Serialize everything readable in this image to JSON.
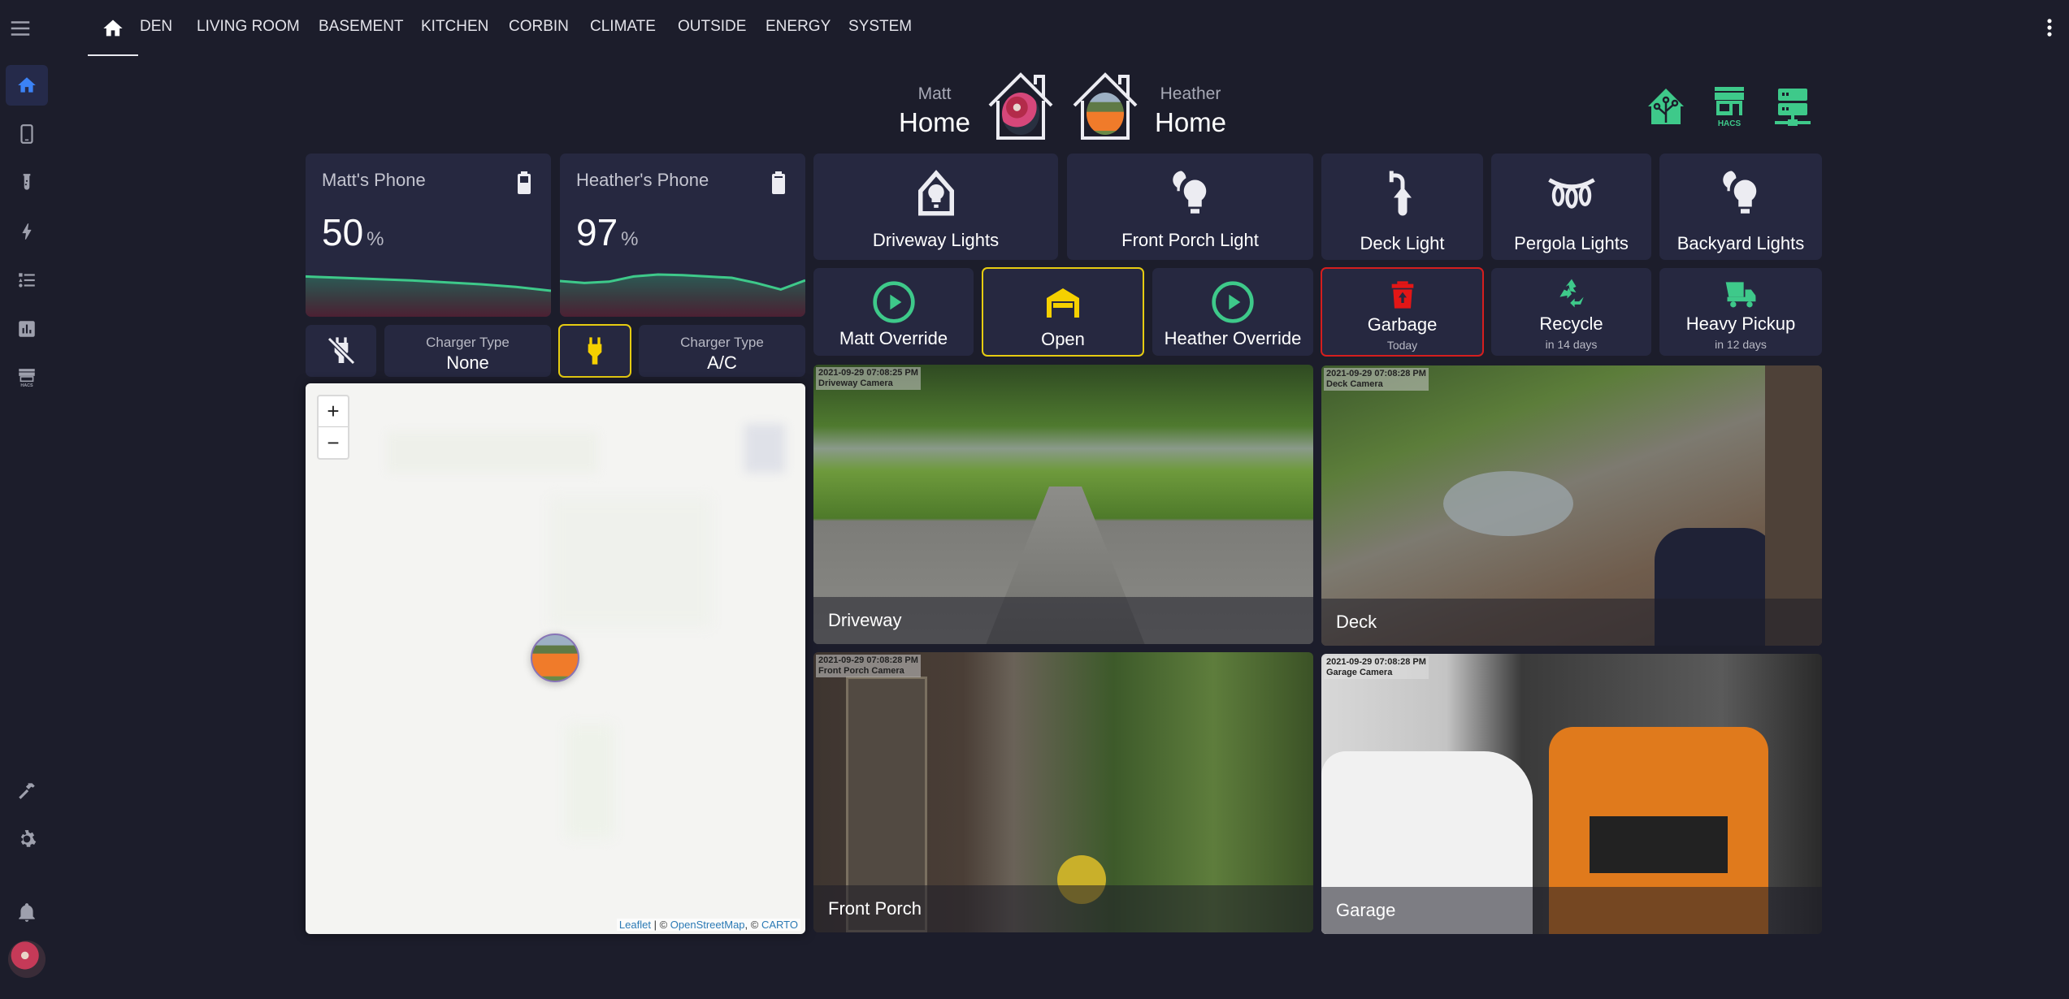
{
  "topbar": {
    "tabs": [
      "DEN",
      "LIVING ROOM",
      "BASEMENT",
      "KITCHEN",
      "CORBIN",
      "CLIMATE",
      "OUTSIDE",
      "ENERGY",
      "SYSTEM"
    ],
    "home_tab_icon": "home-icon",
    "menu_icon": "hamburger-menu-icon",
    "overflow_icon": "dots-vertical-icon"
  },
  "sidebar": {
    "items": [
      {
        "icon": "home-icon",
        "active": true
      },
      {
        "icon": "cellphone-icon"
      },
      {
        "icon": "test-tube-icon"
      },
      {
        "icon": "lightning-bolt-icon"
      },
      {
        "icon": "format-list-icon"
      },
      {
        "icon": "chart-box-icon"
      },
      {
        "icon": "hacs-icon"
      }
    ],
    "bottom": [
      {
        "icon": "hammer-icon"
      },
      {
        "icon": "cog-icon"
      },
      {
        "icon": "bell-icon"
      },
      {
        "icon": "user-avatar"
      }
    ],
    "accent": "#3b82f6"
  },
  "header": {
    "people": [
      {
        "name": "Matt",
        "state": "Home"
      },
      {
        "name": "Heather",
        "state": "Home"
      }
    ],
    "shortcut_icons": [
      "home-assistant-icon",
      "hacs-store-icon",
      "server-network-icon"
    ],
    "shortcut_labels": {
      "hacs": "HACS"
    },
    "accent": "#3ec98a"
  },
  "phones": [
    {
      "title": "Matt's Phone",
      "value": "50",
      "unit": "%",
      "icon": "battery-50-icon",
      "history": [
        0.62,
        0.6,
        0.58,
        0.56,
        0.53,
        0.5,
        0.46,
        0.4
      ]
    },
    {
      "title": "Heather's Phone",
      "value": "97",
      "unit": "%",
      "icon": "battery-90-icon",
      "history": [
        0.55,
        0.52,
        0.54,
        0.62,
        0.65,
        0.64,
        0.62,
        0.6,
        0.52,
        0.42,
        0.56
      ]
    }
  ],
  "chargers": [
    {
      "icon": "power-plug-off-icon",
      "label": "Charger Type",
      "value": "None",
      "active": false
    },
    {
      "icon": "power-plug-icon",
      "label": "Charger Type",
      "value": "A/C",
      "active": true
    }
  ],
  "lights": [
    {
      "label": "Driveway Lights",
      "icon": "home-lightbulb-icon"
    },
    {
      "label": "Front Porch Light",
      "icon": "lightbulb-group-icon"
    },
    {
      "label": "Deck Light",
      "icon": "outdoor-lamp-icon"
    },
    {
      "label": "Pergola Lights",
      "icon": "string-lights-icon"
    },
    {
      "label": "Backyard Lights",
      "icon": "lightbulb-group-icon"
    }
  ],
  "actions": [
    {
      "label": "Matt Override",
      "icon": "play-circle-icon",
      "color": "#3ec98a"
    },
    {
      "label": "Open",
      "icon": "garage-open-icon",
      "color": "#f5d000",
      "highlight": "yellow"
    },
    {
      "label": "Heather Override",
      "icon": "play-circle-icon",
      "color": "#3ec98a"
    },
    {
      "label": "Garbage",
      "sub": "Today",
      "icon": "trash-can-icon",
      "color": "#e31616",
      "highlight": "red"
    },
    {
      "label": "Recycle",
      "sub": "in 14 days",
      "icon": "recycle-icon",
      "color": "#3ec98a"
    },
    {
      "label": "Heavy Pickup",
      "sub": "in 12 days",
      "icon": "dump-truck-icon",
      "color": "#3ec98a"
    }
  ],
  "map": {
    "zoom_in": "+",
    "zoom_out": "−",
    "attribution": {
      "leaflet": "Leaflet",
      "sep": " | © ",
      "osm": "OpenStreetMap",
      "sep2": ", © ",
      "carto": "CARTO"
    }
  },
  "cameras": [
    {
      "name": "Driveway",
      "stamp": "2021-09-29 07:08:25 PM",
      "source": "Driveway Camera"
    },
    {
      "name": "Deck",
      "stamp": "2021-09-29 07:08:28 PM",
      "source": "Deck Camera"
    },
    {
      "name": "Front Porch",
      "stamp": "2021-09-29 07:08:28 PM",
      "source": "Front Porch Camera"
    },
    {
      "name": "Garage",
      "stamp": "2021-09-29 07:08:28 PM",
      "source": "Garage Camera"
    }
  ]
}
